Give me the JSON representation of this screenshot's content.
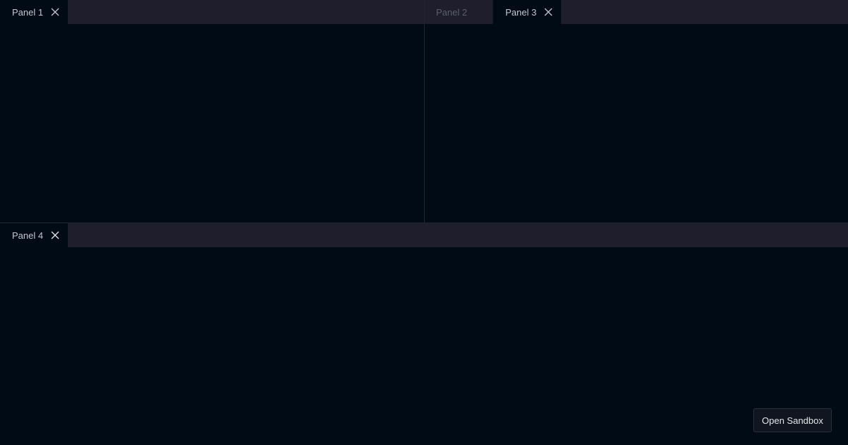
{
  "panels": {
    "top_left": {
      "tabs": [
        {
          "label": "Panel 1",
          "active": true
        }
      ]
    },
    "top_right": {
      "tabs": [
        {
          "label": "Panel 2",
          "active": false
        },
        {
          "label": "Panel 3",
          "active": true
        }
      ]
    },
    "bottom": {
      "tabs": [
        {
          "label": "Panel 4",
          "active": true
        }
      ]
    }
  },
  "sandbox_button": {
    "label": "Open Sandbox"
  },
  "icons": {
    "close": "close-icon"
  },
  "colors": {
    "background": "#000b16",
    "tabbar": "#1e1e2c",
    "active_tab_text": "#c3c6ce",
    "inactive_tab_text": "#5b5e6a",
    "divider": "#202532"
  }
}
